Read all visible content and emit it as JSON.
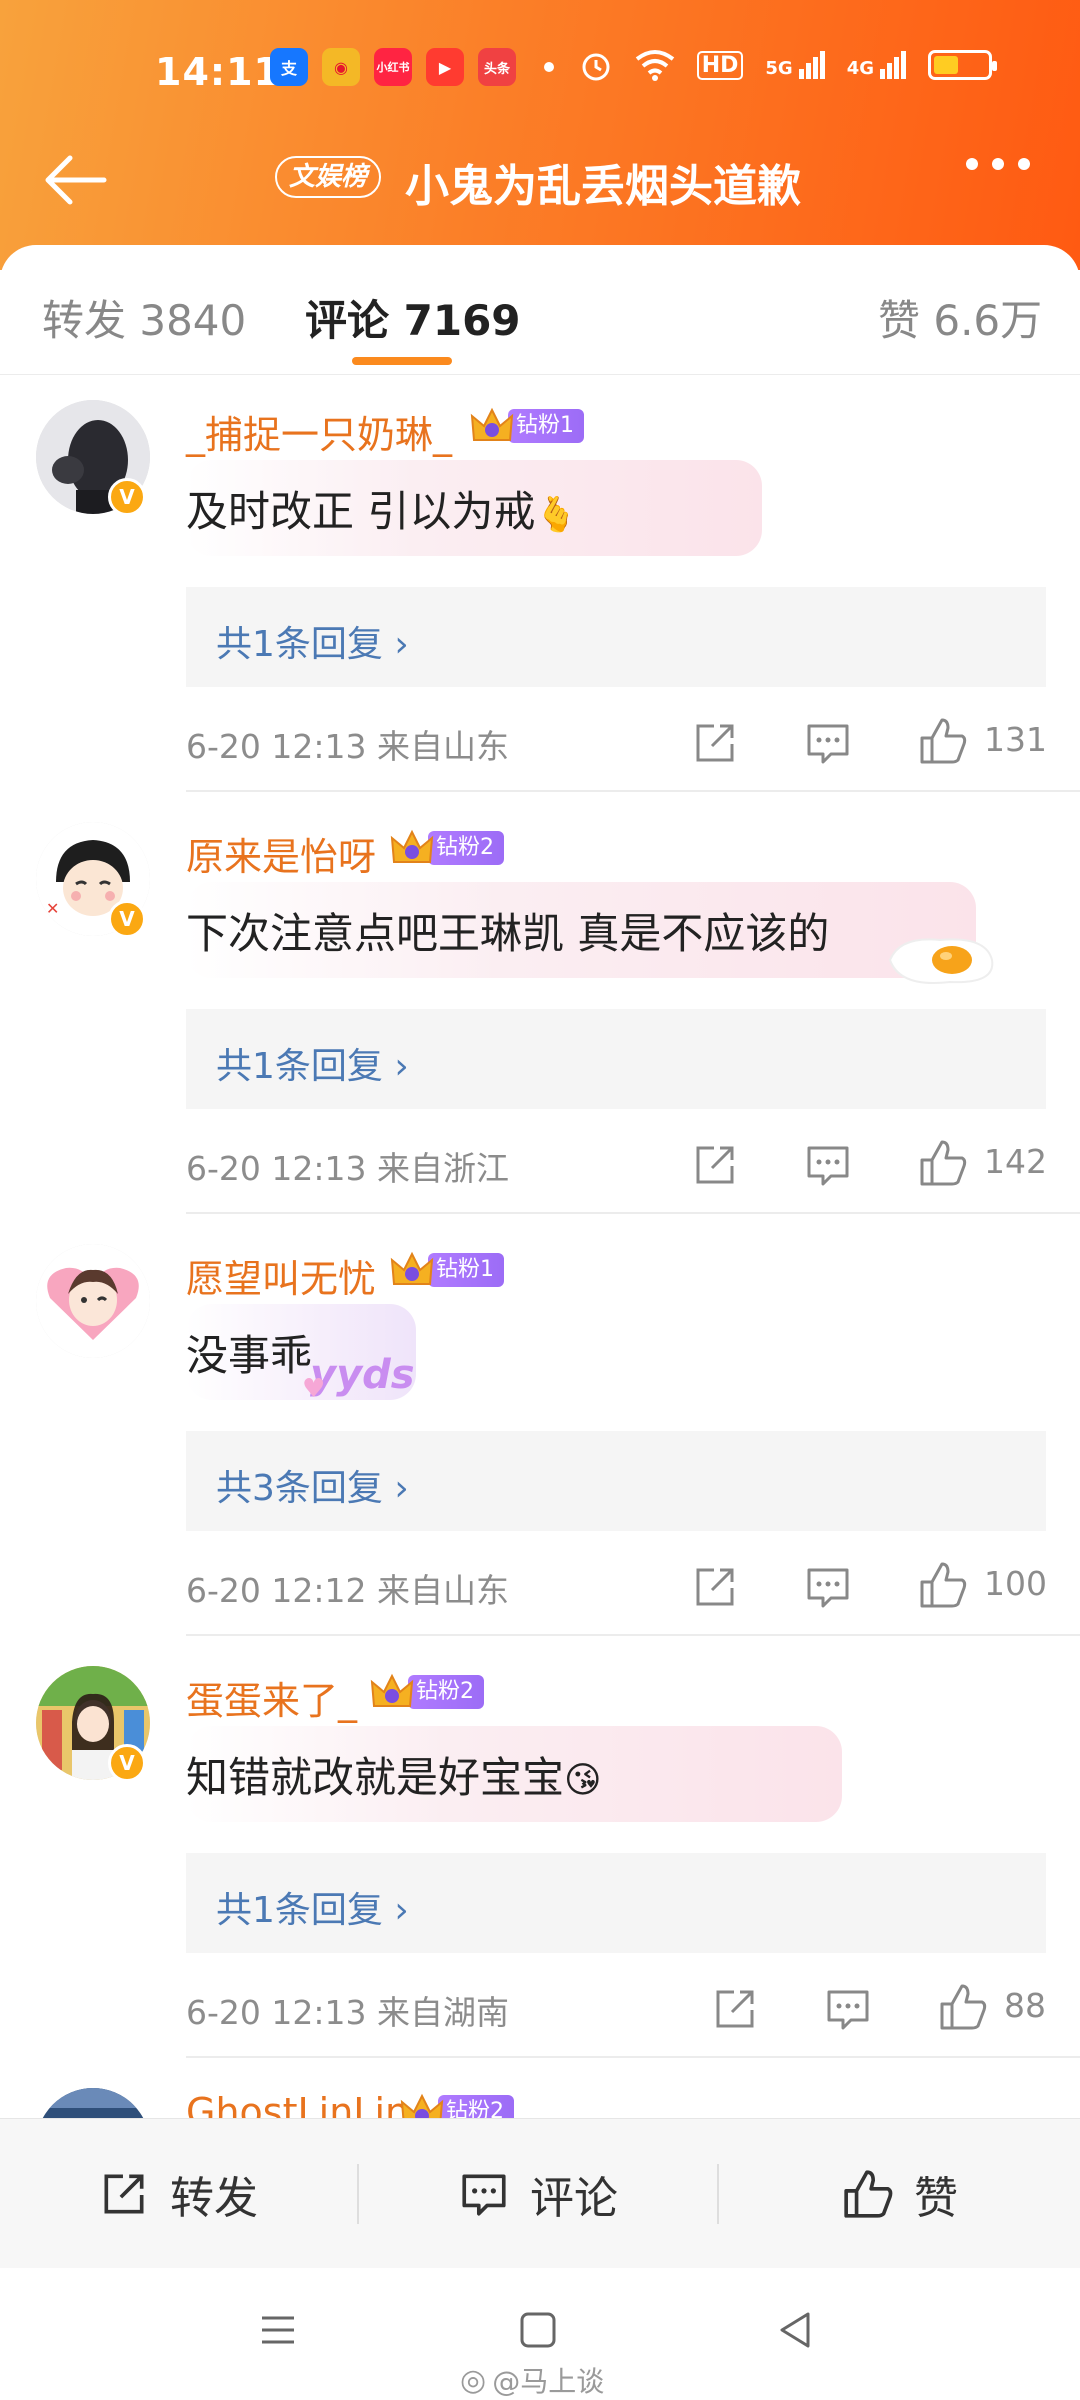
{
  "status_bar": {
    "time": "14:11",
    "app_icons": [
      {
        "name": "alipay-icon",
        "glyph": "支",
        "color": "#1677ff"
      },
      {
        "name": "weibo-icon",
        "glyph": "◉",
        "color": "#f4b826"
      },
      {
        "name": "xiaohongshu-icon",
        "glyph": "小红书",
        "color": "#ff2442"
      },
      {
        "name": "video-app-icon",
        "glyph": "▶",
        "color": "#ff3b30"
      },
      {
        "name": "toutiao-icon",
        "glyph": "头条",
        "color": "#f04142"
      }
    ],
    "signal_labels": [
      "HD",
      "5G",
      "4G"
    ]
  },
  "titlebar": {
    "rank_badge": "文娱榜",
    "title": "小鬼为乱丢烟头道歉"
  },
  "tabs": {
    "repost": "转发 3840",
    "comments": "评论 7169",
    "likes": "赞 6.6万"
  },
  "comments": [
    {
      "username": "_捕捉一只奶琳_",
      "fan_badge": "钻粉1",
      "text": "及时改正 引以为戒",
      "emoji": "🫰",
      "reply_summary": "共1条回复",
      "meta": "6-20 12:13  来自山东",
      "likes": "131"
    },
    {
      "username": "原来是怡呀",
      "fan_badge": "钻粉2",
      "text": "下次注意点吧王琳凯  真是不应该的",
      "emoji": "🍳",
      "reply_summary": "共1条回复",
      "meta": "6-20 12:13  来自浙江",
      "likes": "142"
    },
    {
      "username": "愿望叫无忧",
      "fan_badge": "钻粉1",
      "text": "没事乖",
      "emoji": "yyds",
      "reply_summary": "共3条回复",
      "meta": "6-20 12:12  来自山东",
      "likes": "100"
    },
    {
      "username": "蛋蛋来了_",
      "fan_badge": "钻粉2",
      "text": "知错就改就是好宝宝",
      "emoji": "😘",
      "reply_summary": "共1条回复",
      "meta": "6-20 12:13  来自湖南",
      "likes": "88"
    },
    {
      "username": "GhostLinLin",
      "fan_badge": "钻粉2"
    }
  ],
  "bottom_bar": {
    "repost": "转发",
    "comment": "评论",
    "like": "赞"
  },
  "watermark": "@马上谈",
  "colors": {
    "header_start": "#f8a23c",
    "header_end": "#ff5a12",
    "username": "#e8731e",
    "reply_link": "#4b79b4",
    "tab_indicator": "#fb8a1e",
    "fan_badge": "#a874fb"
  }
}
